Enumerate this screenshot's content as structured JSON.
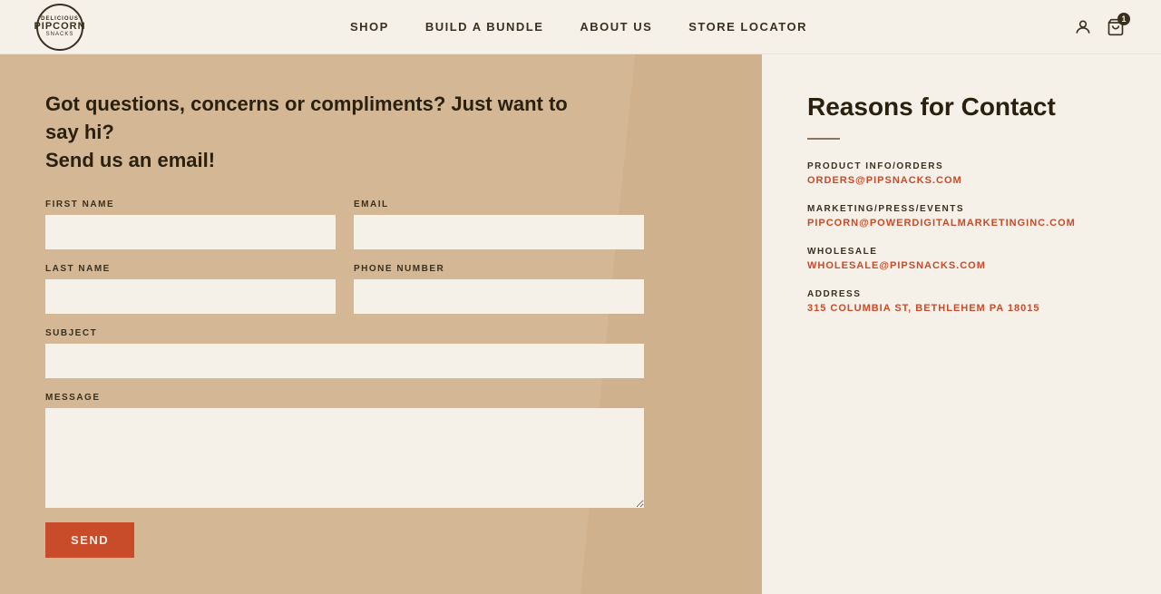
{
  "header": {
    "logo": {
      "top": "DELICIOUS",
      "main": "PIPCORN",
      "sub": "SNACKS"
    },
    "nav": {
      "items": [
        {
          "label": "SHOP",
          "href": "#"
        },
        {
          "label": "BUILD A BUNDLE",
          "href": "#"
        },
        {
          "label": "ABOUT US",
          "href": "#"
        },
        {
          "label": "STORE LOCATOR",
          "href": "#"
        }
      ]
    },
    "cart_count": "1"
  },
  "form_section": {
    "heading_line1": "Got questions, concerns or compliments? Just want to say hi?",
    "heading_line2": "Send us an email!",
    "fields": {
      "first_name_label": "FIRST NAME",
      "email_label": "EMAIL",
      "last_name_label": "LAST NAME",
      "phone_label": "PHONE NUMBER",
      "subject_label": "SUBJECT",
      "message_label": "MESSAGE"
    },
    "send_button": "SEND"
  },
  "contact_info": {
    "title": "Reasons for Contact",
    "divider": true,
    "items": [
      {
        "label": "PRODUCT INFO/ORDERS",
        "value": "ORDERS@PIPSNACKS.COM"
      },
      {
        "label": "MARKETING/PRESS/EVENTS",
        "value": "PIPCORN@POWERDIGITALMARKETINGINC.COM"
      },
      {
        "label": "WHOLESALE",
        "value": "WHOLESALE@PIPSNACKS.COM"
      },
      {
        "label": "ADDRESS",
        "value": "315 COLUMBIA ST, BETHLEHEM PA 18015"
      }
    ]
  }
}
